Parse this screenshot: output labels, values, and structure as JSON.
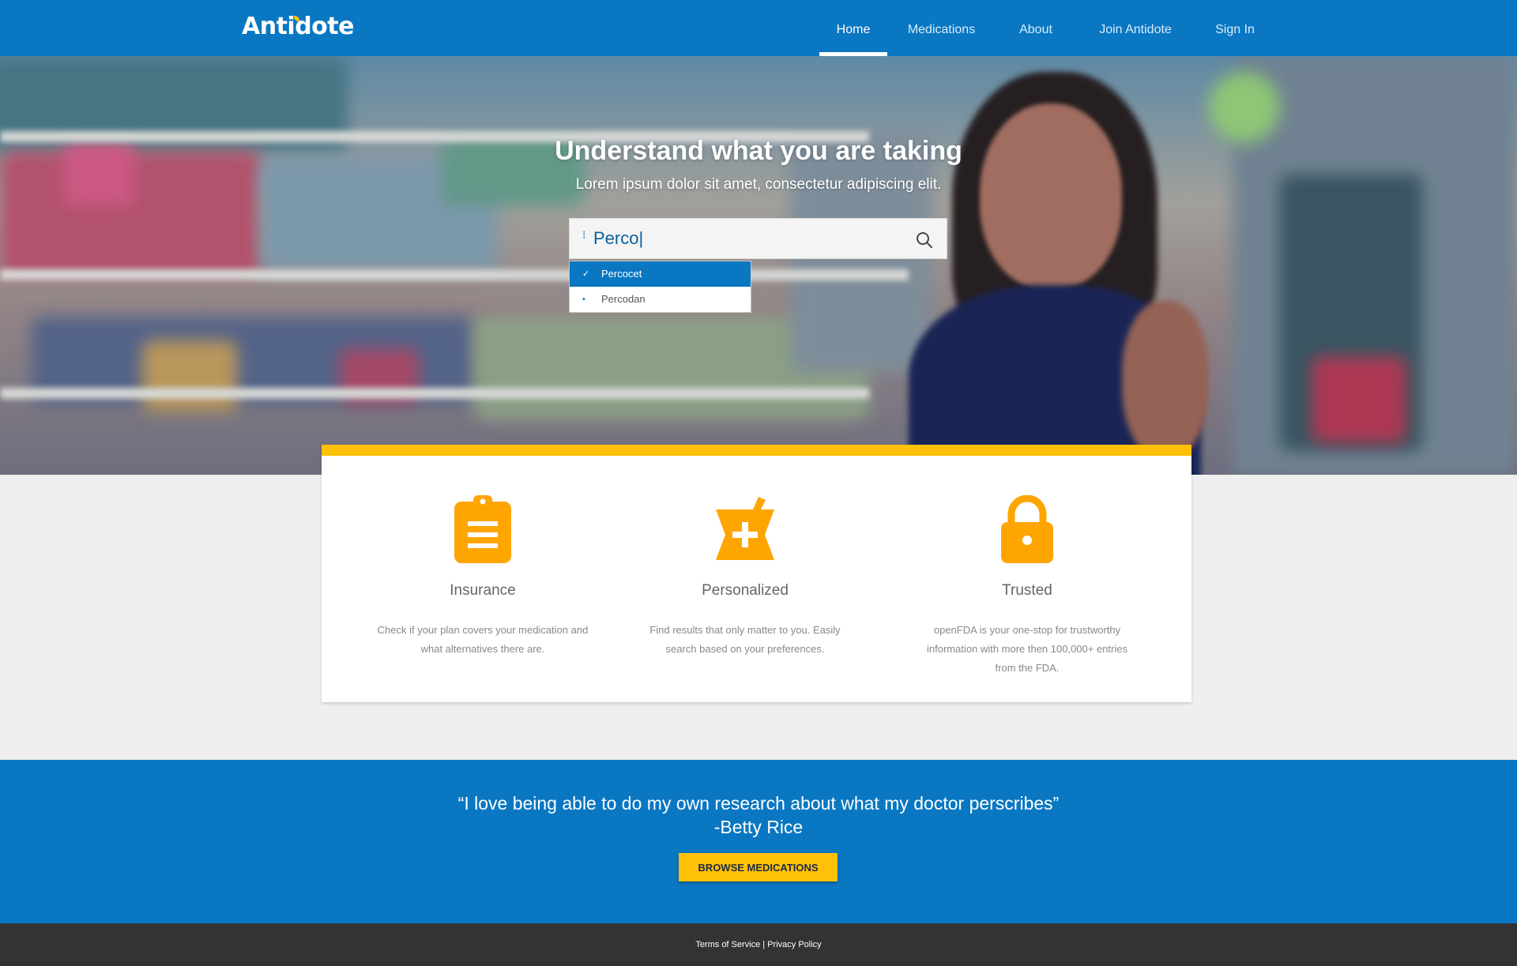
{
  "nav": {
    "logo": "Antidote",
    "links": [
      {
        "label": "Home",
        "active": true
      },
      {
        "label": "Medications",
        "active": false
      },
      {
        "label": "About",
        "active": false
      },
      {
        "label": "Join Antidote",
        "active": false
      },
      {
        "label": "Sign In",
        "active": false
      }
    ]
  },
  "hero": {
    "title": "Understand what you are taking",
    "subtitle": "Lorem ipsum dolor sit amet, consectetur adipiscing elit.",
    "search": {
      "value": "Perco|",
      "icon": "search-icon"
    },
    "suggestions": [
      {
        "label": "Percocet",
        "selected": true,
        "mark": "✓"
      },
      {
        "label": "Percodan",
        "selected": false,
        "mark": "•"
      }
    ]
  },
  "features": [
    {
      "icon": "clipboard-icon",
      "title": "Insurance",
      "text": "Check if your plan covers your medication and what alternatives there are."
    },
    {
      "icon": "mortar-pestle-icon",
      "title": "Personalized",
      "text": "Find results that only matter to you. Easily search based on your preferences."
    },
    {
      "icon": "lock-icon",
      "title": "Trusted",
      "text": "openFDA is your one-stop for trustworthy information with more then 100,000+ entries from the FDA."
    }
  ],
  "testimonial": {
    "quote": "“I love being able to do my own research about what my doctor perscribes”",
    "author": "-Betty Rice",
    "button": "BROWSE MEDICATIONS"
  },
  "footer": {
    "terms": "Terms of Service",
    "separator": "|",
    "privacy": "Privacy Policy"
  },
  "colors": {
    "brand_blue": "#0a77c2",
    "accent_yellow": "#ffc107",
    "icon_orange": "#ffa500",
    "footer_dark": "#333333"
  }
}
